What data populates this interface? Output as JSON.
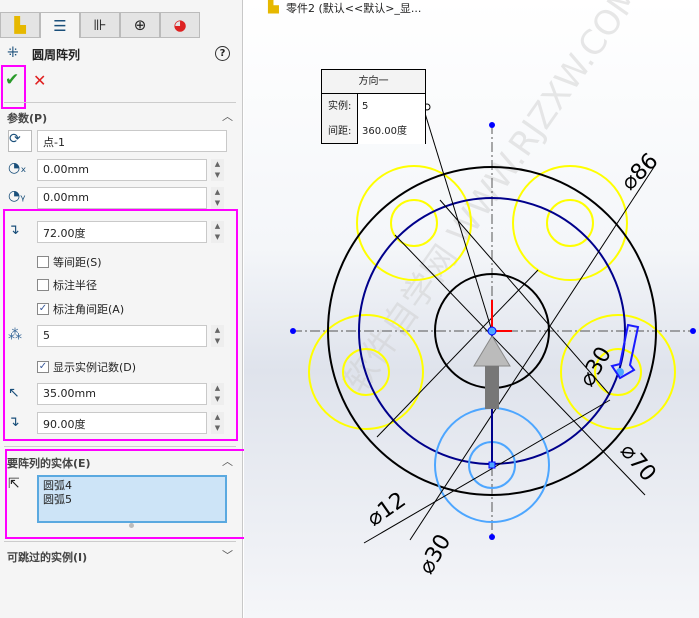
{
  "panel": {
    "tabs": [
      {
        "icon": "feature-manager-icon"
      },
      {
        "icon": "property-manager-icon"
      },
      {
        "icon": "configuration-manager-icon"
      },
      {
        "icon": "dimxpert-icon"
      },
      {
        "icon": "display-manager-icon"
      }
    ],
    "title": "圆周阵列",
    "ok_icon": "checkmark-icon",
    "cancel_icon": "x-icon",
    "help_icon": "help-icon",
    "params": {
      "header": "参数(P)",
      "center": "点-1",
      "x": "0.00mm",
      "y": "0.00mm",
      "angle1": "72.00度",
      "equal_spacing": {
        "label": "等间距(S)",
        "checked": false
      },
      "dim_radius": {
        "label": "标注半径",
        "checked": false
      },
      "dim_angle": {
        "label": "标注角间距(A)",
        "checked": true
      },
      "count": "5",
      "show_count": {
        "label": "显示实例记数(D)",
        "checked": true
      },
      "radius": "35.00mm",
      "angle2": "90.00度"
    },
    "entities": {
      "header": "要阵列的实体(E)",
      "items": [
        "圆弧4",
        "圆弧5"
      ]
    },
    "skip": {
      "header": "可跳过的实例(I)"
    }
  },
  "canvas": {
    "breadcrumb": "零件2  (默认<<默认>_显...",
    "callout": {
      "title": "方向一",
      "instances_label": "实例:",
      "instances": "5",
      "spacing_label": "间距:",
      "spacing": "360.00度"
    },
    "dims": [
      "⌀86",
      "⌀70",
      "⌀30",
      "⌀12",
      "⌀30"
    ],
    "watermark": "软件自学网 WWW.RJZXW.COM",
    "colors": {
      "highlight": "#ff00ff",
      "pattern": "#ffff00",
      "selected": "#4da6ff",
      "sketch": "#00008b"
    }
  }
}
